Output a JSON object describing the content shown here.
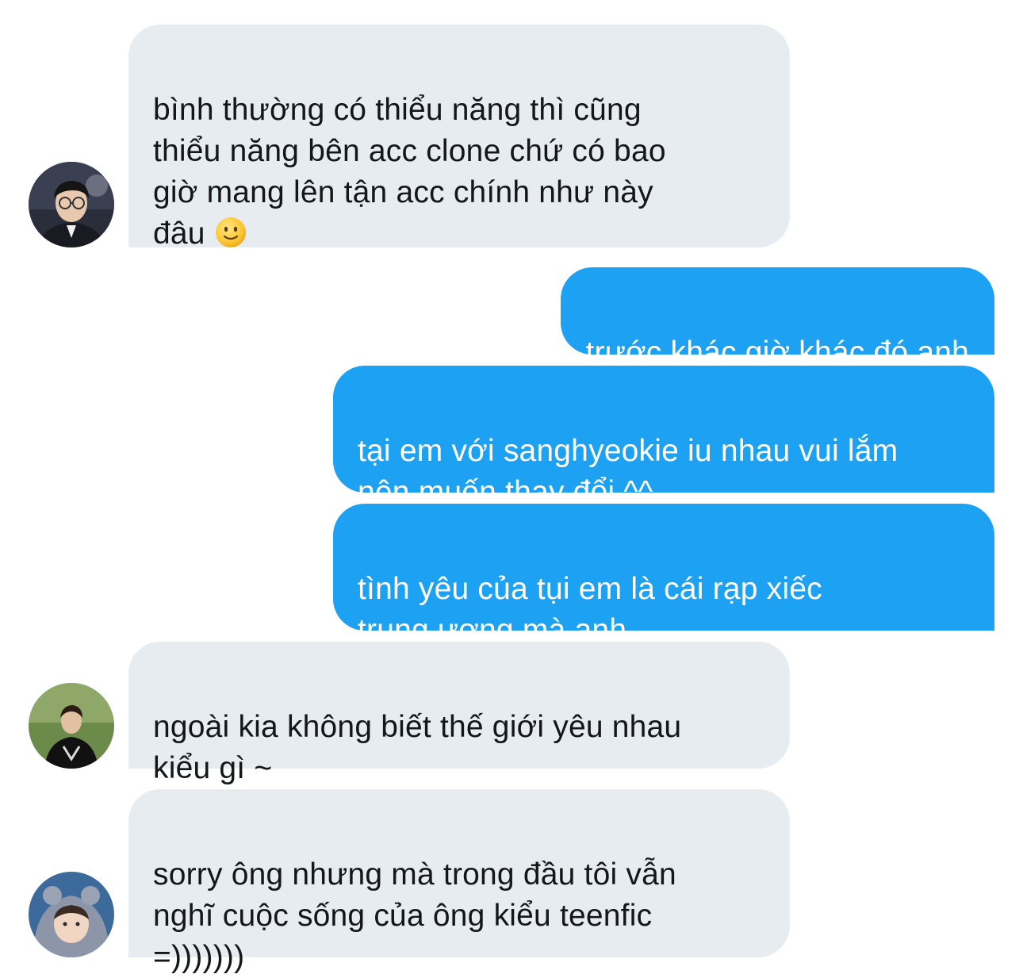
{
  "messages": [
    {
      "direction": "incoming",
      "text": "bình thường có thiểu năng thì cũng\nthiểu năng bên acc clone chứ có bao\ngiờ mang lên tận acc chính như này\nđâu",
      "emoji": "slightly-smiling-face-icon",
      "avatar": "avatar-user-glasses"
    },
    {
      "direction": "outgoing",
      "text": "trước khác giờ khác đó anh"
    },
    {
      "direction": "outgoing",
      "text": "tại em với sanghyeokie iu nhau vui lắm\nnên muốn thay đổi ^^"
    },
    {
      "direction": "outgoing",
      "text": "tình yêu của tụi em là cái rạp xiếc\ntrung ương mà anh"
    },
    {
      "direction": "incoming",
      "text": "ngoài kia không biết thế giới yêu nhau\nkiểu gì ~",
      "avatar": "avatar-user-jersey"
    },
    {
      "direction": "incoming",
      "text": "sorry ông nhưng mà trong đầu tôi vẫn\nnghĩ cuộc sống của ông kiểu teenfic\n=)))))))",
      "avatar": "avatar-user-hood"
    }
  ],
  "colors": {
    "incoming_bubble": "#e6ecf0",
    "outgoing_bubble": "#1da1f2",
    "incoming_text": "#14171a",
    "outgoing_text": "#ffffff"
  }
}
